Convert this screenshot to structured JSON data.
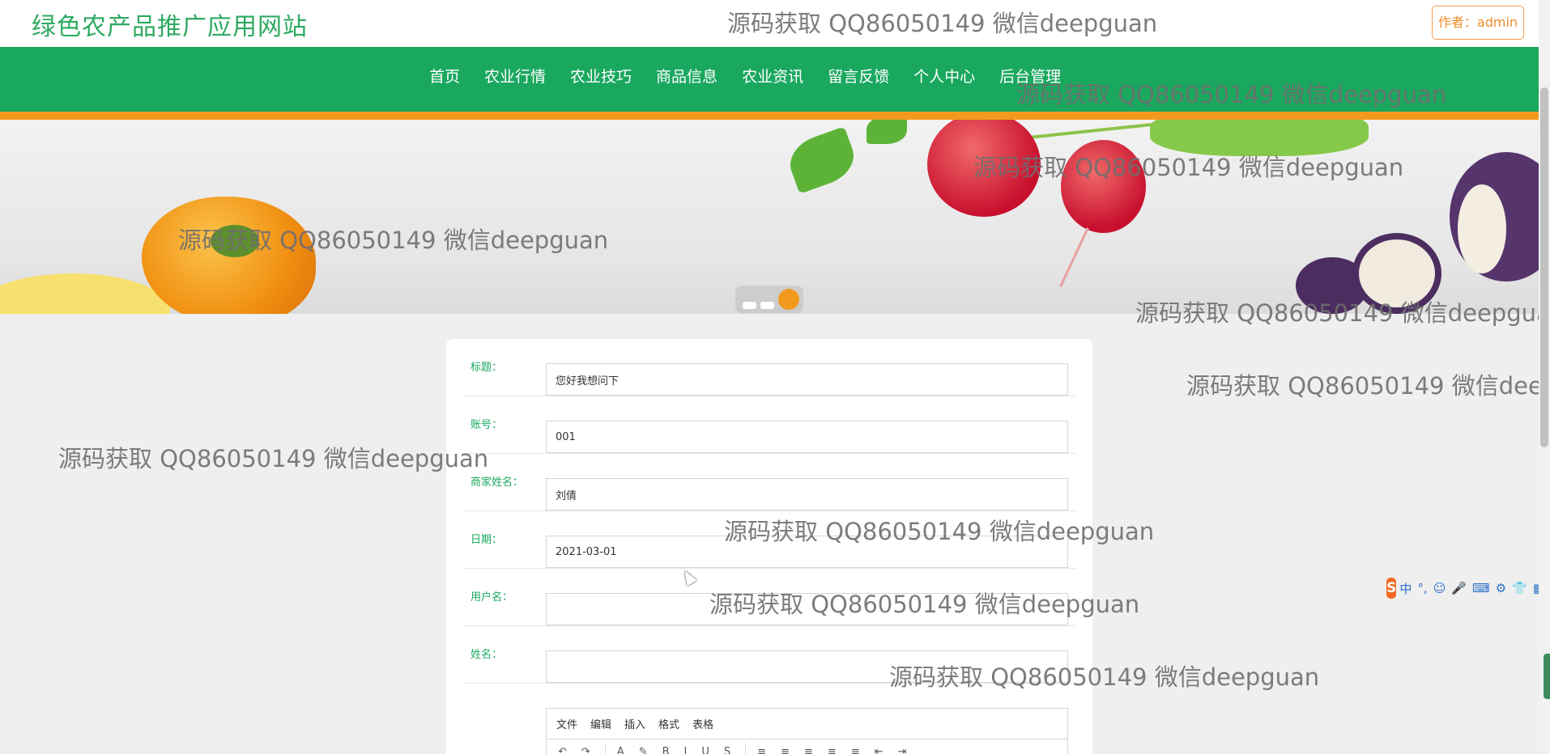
{
  "header": {
    "site_title": "绿色农产品推广应用网站",
    "author_label": "作者：admin"
  },
  "nav": {
    "items": [
      "首页",
      "农业行情",
      "农业技巧",
      "商品信息",
      "农业资讯",
      "留言反馈",
      "个人中心",
      "后台管理"
    ]
  },
  "banner": {
    "slides_count": 3,
    "active_slide": 3
  },
  "form": {
    "fields": [
      {
        "label": "标题：",
        "value": "您好我想问下"
      },
      {
        "label": "账号：",
        "value": "001"
      },
      {
        "label": "商家姓名：",
        "value": "刘倩"
      },
      {
        "label": "日期：",
        "value": "2021-03-01"
      },
      {
        "label": "用户名：",
        "value": ""
      },
      {
        "label": "姓名：",
        "value": ""
      }
    ],
    "editor_menu": [
      "文件",
      "编辑",
      "插入",
      "格式",
      "表格"
    ]
  },
  "watermark_text": "源码获取 QQ86050149 微信deepguan",
  "ime": {
    "logo": "S",
    "items": [
      "中",
      "°,",
      "☺",
      "🎤",
      "⌨",
      "⚙",
      "👕",
      "▦"
    ]
  },
  "colors": {
    "brand_green": "#1aa85f",
    "accent_orange": "#f39a1e",
    "author_border": "#f29b4b"
  }
}
